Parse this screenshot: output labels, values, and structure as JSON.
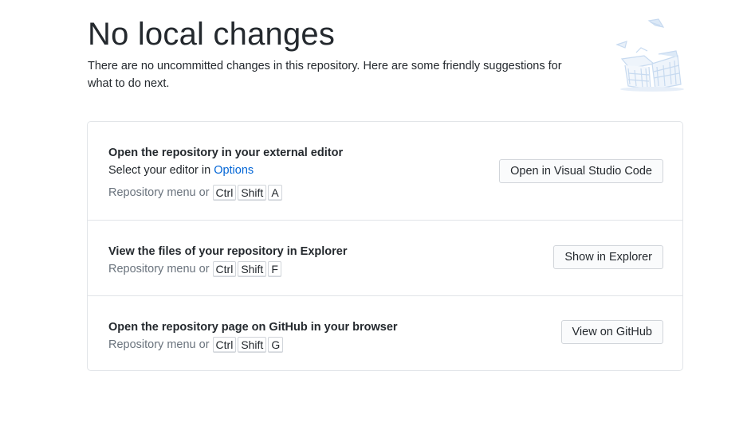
{
  "header": {
    "title": "No local changes",
    "subtitle": "There are no uncommitted changes in this repository. Here are some friendly suggestions for what to do next."
  },
  "illustration": {
    "icon": "empty-paper-stack-illustration",
    "color": "#c7daf0"
  },
  "actions": [
    {
      "title": "Open the repository in your external editor",
      "editor_prefix": "Select your editor in ",
      "editor_link": "Options",
      "shortcut_prefix": "Repository menu or",
      "keys": [
        "Ctrl",
        "Shift",
        "A"
      ],
      "button": "Open in Visual Studio Code"
    },
    {
      "title": "View the files of your repository in Explorer",
      "shortcut_prefix": "Repository menu or",
      "keys": [
        "Ctrl",
        "Shift",
        "F"
      ],
      "button": "Show in Explorer"
    },
    {
      "title": "Open the repository page on GitHub in your browser",
      "shortcut_prefix": "Repository menu or",
      "keys": [
        "Ctrl",
        "Shift",
        "G"
      ],
      "button": "View on GitHub"
    }
  ],
  "colors": {
    "link": "#0366d6",
    "muted_text": "#6a737d",
    "border": "#e1e4e8"
  }
}
